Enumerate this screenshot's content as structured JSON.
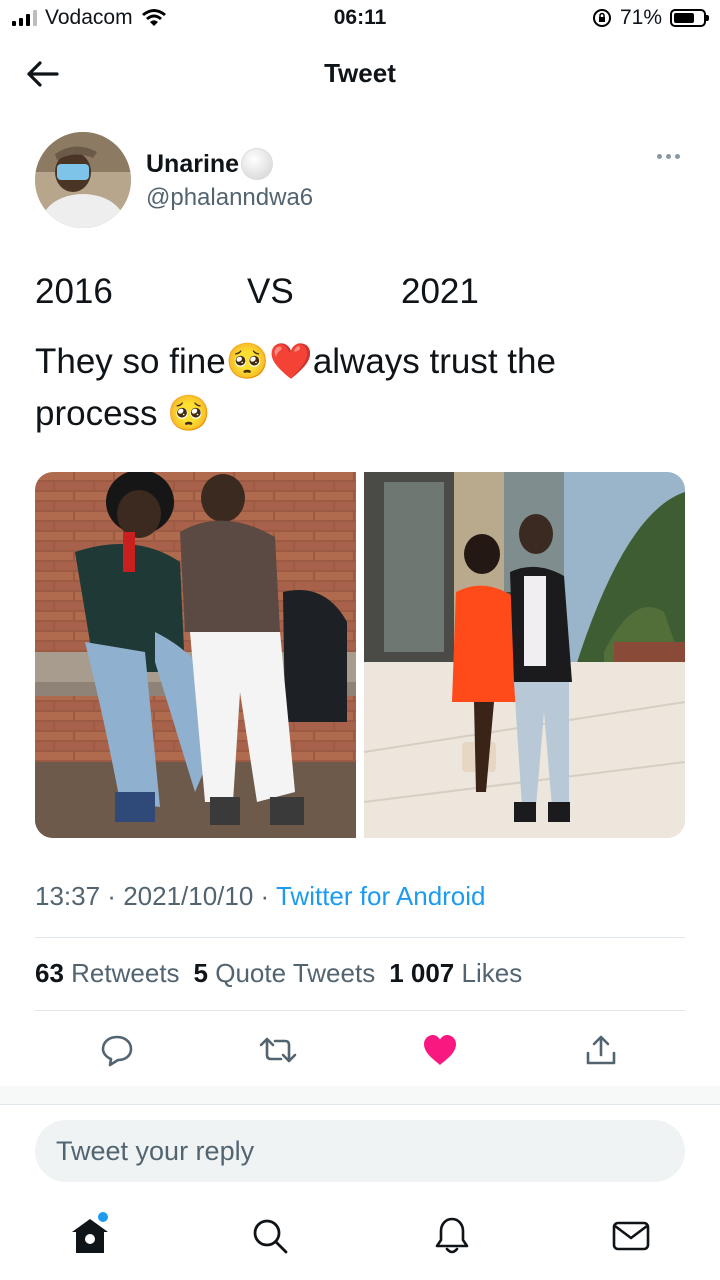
{
  "status_bar": {
    "carrier": "Vodacom",
    "time": "06:11",
    "battery": "71%",
    "battery_level": 0.71
  },
  "header": {
    "title": "Tweet"
  },
  "tweet": {
    "author_name": "Unarine",
    "author_handle": "@phalanndwa6",
    "line1": {
      "left": "2016",
      "middle": "VS",
      "right": "2021"
    },
    "text_line1": "They so fine🥺❤️always trust the",
    "text_line2": "process 🥺",
    "time": "13:37",
    "date": "2021/10/10",
    "source": "Twitter for Android",
    "retweets_count": "63",
    "retweets_label": "Retweets",
    "quotes_count": "5",
    "quotes_label": "Quote Tweets",
    "likes_count": "1 007",
    "likes_label": "Likes"
  },
  "reply": {
    "placeholder": "Tweet your reply"
  },
  "colors": {
    "accent": "#1d9bf0",
    "like": "#f91880",
    "muted": "#536471"
  },
  "icons": {
    "header": "back-arrow-icon",
    "actions": [
      "reply-icon",
      "retweet-icon",
      "like-icon",
      "share-icon"
    ],
    "tabs": [
      "home-icon",
      "search-icon",
      "notifications-icon",
      "messages-icon"
    ]
  }
}
